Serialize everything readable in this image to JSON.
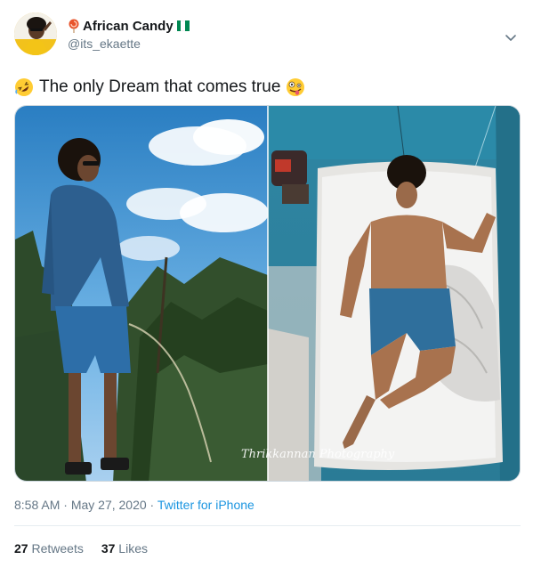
{
  "author": {
    "display_name": "African Candy",
    "handle": "@its_ekaette",
    "name_emoji_icon": "lollipop-icon",
    "flag": "nigeria-flag-icon",
    "flag_colors": [
      "#008751",
      "#ffffff",
      "#008751"
    ]
  },
  "tweet": {
    "text": "The only Dream that comes true",
    "leading_emoji": "rolling-on-floor-laughing-icon",
    "trailing_emoji": "zany-face-icon"
  },
  "media": {
    "watermark": "Thrikkannan Photography"
  },
  "meta": {
    "time": "8:58 AM",
    "date": "May 27, 2020",
    "separator": " · ",
    "source": "Twitter for iPhone"
  },
  "stats": {
    "retweets_count": "27",
    "retweets_label": "Retweets",
    "likes_count": "37",
    "likes_label": "Likes"
  },
  "colors": {
    "link": "#1b95e0",
    "secondary_text": "#657786",
    "divider": "#e6ecf0"
  }
}
